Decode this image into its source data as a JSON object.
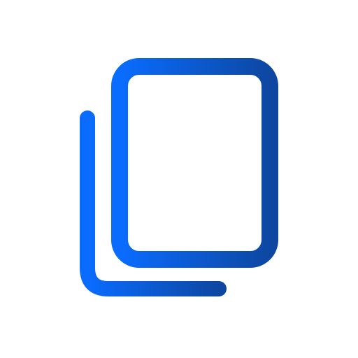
{
  "icon": {
    "name": "copy-icon",
    "gradient": {
      "start": "#0a6cff",
      "end": "#0d47a1"
    },
    "background": "#ffffff"
  }
}
